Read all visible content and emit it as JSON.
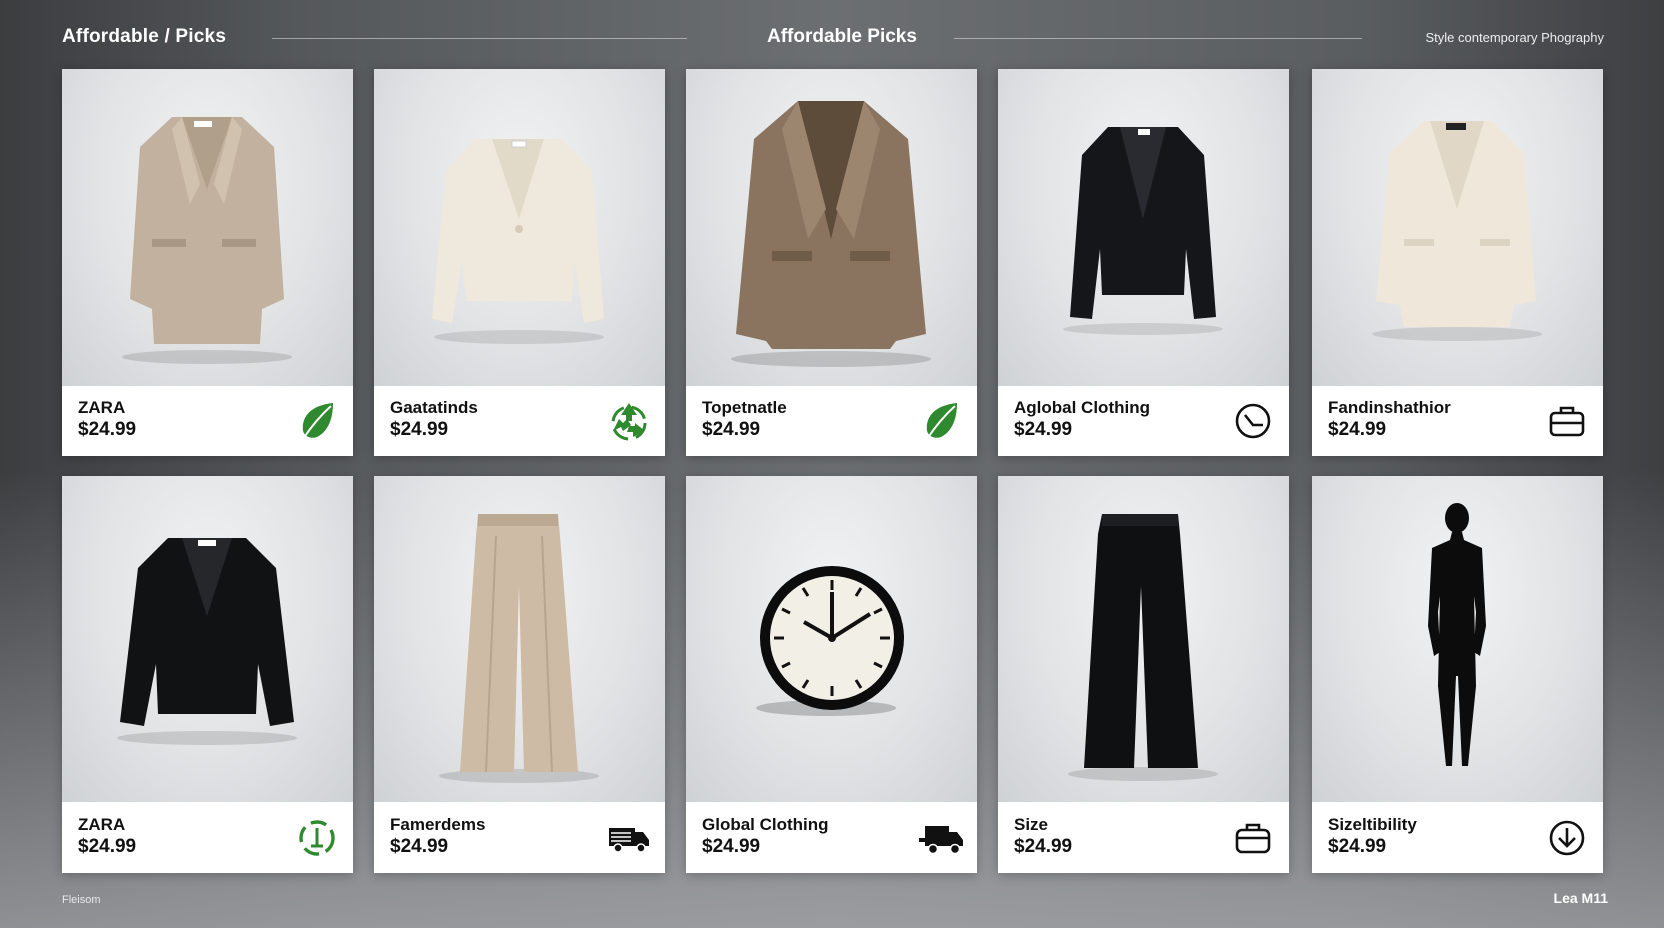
{
  "header": {
    "brand": "Affordable / Picks",
    "center_title": "Affordable Picks",
    "tagline": "Style contemporary Phography"
  },
  "products": [
    {
      "brand": "ZARA",
      "price": "$24.99",
      "icon": "leaf-icon",
      "item": "beige coat"
    },
    {
      "brand": "Gaatatinds",
      "price": "$24.99",
      "icon": "recycle-icon",
      "item": "cream cropped jacket"
    },
    {
      "brand": "Topetnatle",
      "price": "$24.99",
      "icon": "leaf-icon",
      "item": "brown coat"
    },
    {
      "brand": "Aglobal Clothing",
      "price": "$24.99",
      "icon": "clock-icon",
      "item": "black blazer"
    },
    {
      "brand": "Fandinshathior",
      "price": "$24.99",
      "icon": "briefcase-icon",
      "item": "cream blazer"
    },
    {
      "brand": "ZARA",
      "price": "$24.99",
      "icon": "recycle-icon",
      "item": "black cropped jacket"
    },
    {
      "brand": "Famerdems",
      "price": "$24.99",
      "icon": "truck-icon",
      "item": "beige wide trousers"
    },
    {
      "brand": "Global Clothing",
      "price": "$24.99",
      "icon": "truck-icon",
      "item": "wall clock"
    },
    {
      "brand": "Size",
      "price": "$24.99",
      "icon": "briefcase-icon",
      "item": "black wide trousers"
    },
    {
      "brand": "Sizeltibility",
      "price": "$24.99",
      "icon": "download-icon",
      "item": "silhouette mannequin"
    }
  ],
  "footer": {
    "left": "Fleisom",
    "right": "Lea M11"
  },
  "colors": {
    "green": "#2f8a2f",
    "dark": "#111111"
  }
}
